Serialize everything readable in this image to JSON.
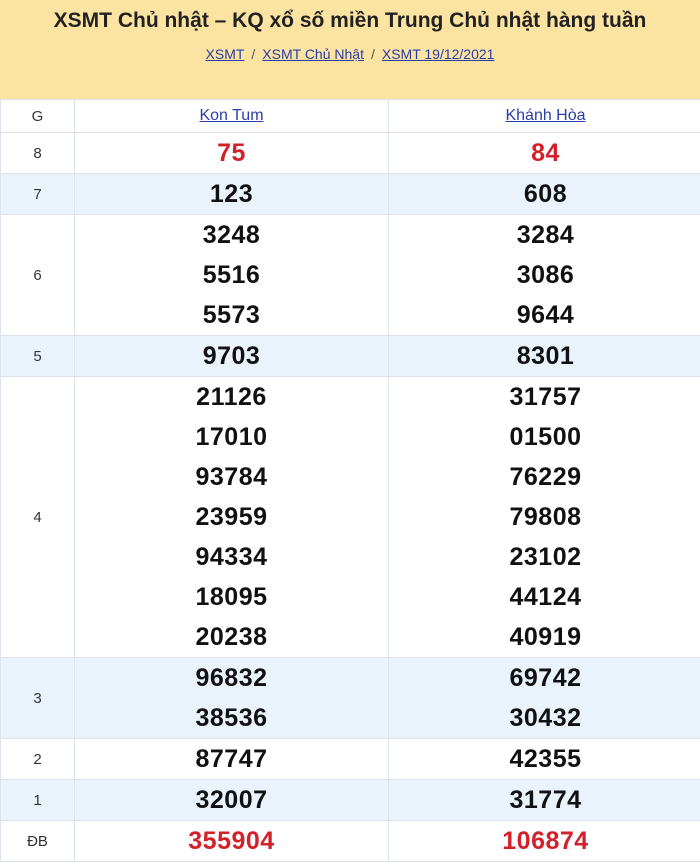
{
  "header": {
    "title": "XSMT Chủ nhật – KQ xổ số miền Trung Chủ nhật hàng tuần",
    "breadcrumb": [
      "XSMT",
      "XSMT Chủ Nhật",
      "XSMT 19/12/2021"
    ],
    "separator": "/"
  },
  "table": {
    "col_g": "G",
    "provinces": [
      "Kon Tum",
      "Khánh Hòa"
    ],
    "prizes": [
      {
        "label": "8",
        "red": true,
        "a": [
          "75"
        ],
        "b": [
          "84"
        ]
      },
      {
        "label": "7",
        "alt": true,
        "a": [
          "123"
        ],
        "b": [
          "608"
        ]
      },
      {
        "label": "6",
        "a": [
          "3248",
          "5516",
          "5573"
        ],
        "b": [
          "3284",
          "3086",
          "9644"
        ]
      },
      {
        "label": "5",
        "alt": true,
        "a": [
          "9703"
        ],
        "b": [
          "8301"
        ]
      },
      {
        "label": "4",
        "a": [
          "21126",
          "17010",
          "93784",
          "23959",
          "94334",
          "18095",
          "20238"
        ],
        "b": [
          "31757",
          "01500",
          "76229",
          "79808",
          "23102",
          "44124",
          "40919"
        ]
      },
      {
        "label": "3",
        "alt": true,
        "a": [
          "96832",
          "38536"
        ],
        "b": [
          "69742",
          "30432"
        ]
      },
      {
        "label": "2",
        "a": [
          "87747"
        ],
        "b": [
          "42355"
        ]
      },
      {
        "label": "1",
        "alt": true,
        "a": [
          "32007"
        ],
        "b": [
          "31774"
        ]
      },
      {
        "label": "ĐB",
        "red": true,
        "a": [
          "355904"
        ],
        "b": [
          "106874"
        ]
      }
    ]
  },
  "colors": {
    "header_bg": "#fbe3a1",
    "alt_row": "#eaf3fb",
    "red": "#d3212a",
    "link": "#2a3da8"
  }
}
